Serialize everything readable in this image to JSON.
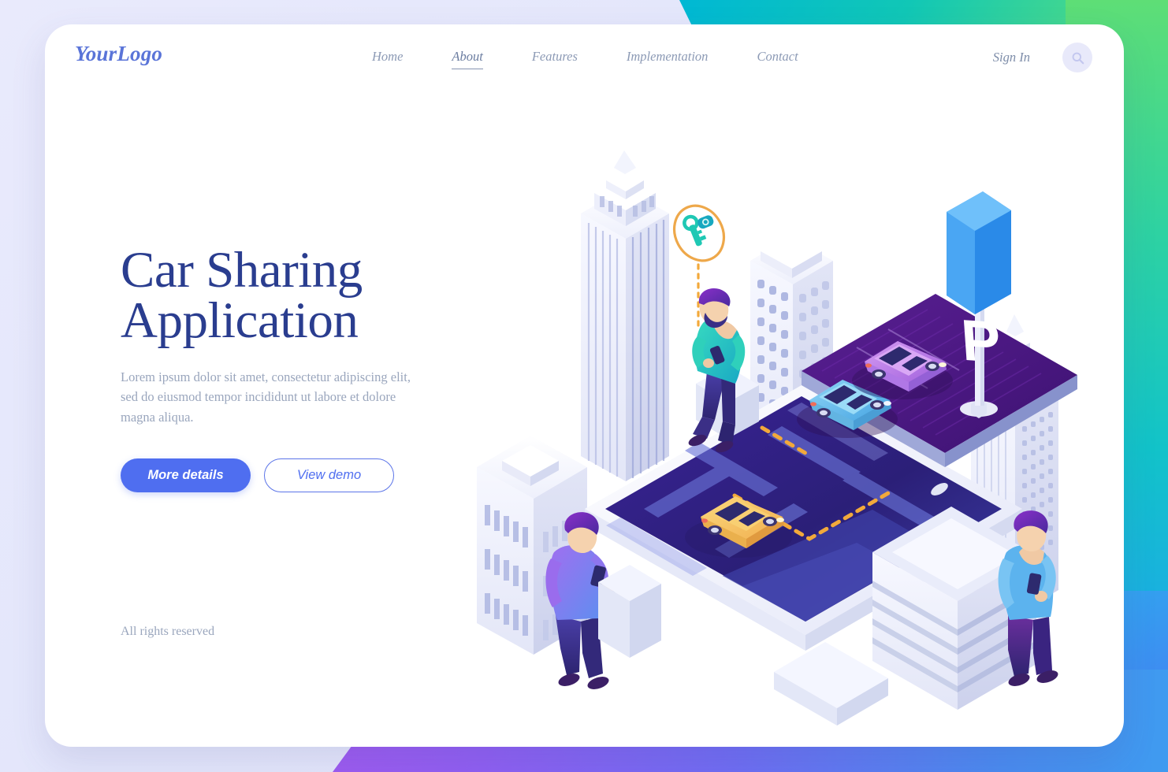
{
  "page": {
    "background_colors": {
      "page_bg": "#e6e8fb",
      "top_right_gradient_from": "#00b8d4",
      "top_right_gradient_to": "#73e06a",
      "bottom_gradient_from": "#9d5bf0",
      "bottom_gradient_to": "#3f9bf0",
      "card_bg": "#ffffff"
    }
  },
  "header": {
    "logo": "YourLogo",
    "logo_color": "#5a74d8",
    "nav": [
      {
        "label": "Home",
        "active": false
      },
      {
        "label": "About",
        "active": true
      },
      {
        "label": "Features",
        "active": false
      },
      {
        "label": "Implementation",
        "active": false
      },
      {
        "label": "Contact",
        "active": false
      }
    ],
    "sign_in": "Sign In",
    "search_icon": "search-icon"
  },
  "hero": {
    "title_line1": "Car Sharing",
    "title_line2": "Application",
    "title_color": "#2a3d8f",
    "subtitle": "Lorem ipsum dolor sit amet, consectetur adipiscing elit, sed do eiusmod tempor incididunt ut labore et dolore magna aliqua.",
    "primary_button": "More details",
    "primary_button_color": "#4f6ef0",
    "secondary_button": "View demo",
    "secondary_button_color": "#4f6ef0"
  },
  "footer": {
    "rights": "All rights reserved"
  },
  "illustration": {
    "name": "isometric-car-sharing-city-scene",
    "parking_sign_letter": "P",
    "parking_sign_color": "#3b9ef5",
    "elements": [
      "smartphone-map-screen",
      "yellow-car-on-map",
      "blue-parked-car",
      "purple-parked-car",
      "parking-lot-platform",
      "parking-sign",
      "car-key-badge",
      "skyscraper-left",
      "skyscraper-mid",
      "skyscraper-right",
      "stepped-office-building",
      "low-rise-building",
      "man-sitting-with-phone",
      "man-standing-with-phone",
      "man-leaning-with-phone"
    ],
    "colors": {
      "yellow_car": "#f7c75a",
      "blue_car": "#5bb8ec",
      "purple_car": "#b277e8",
      "parking_surface": "#4a1d82",
      "map_screen": "#2c1f7a",
      "road_lines": "#6b76d8",
      "route_dashes": "#f2a93b",
      "key_badge_outline": "#eea84a",
      "key_color": "#1fc8b4",
      "building_light": "#f4f5ff",
      "building_shade": "#d7daf2",
      "window_blue": "#a8b2e0"
    }
  }
}
